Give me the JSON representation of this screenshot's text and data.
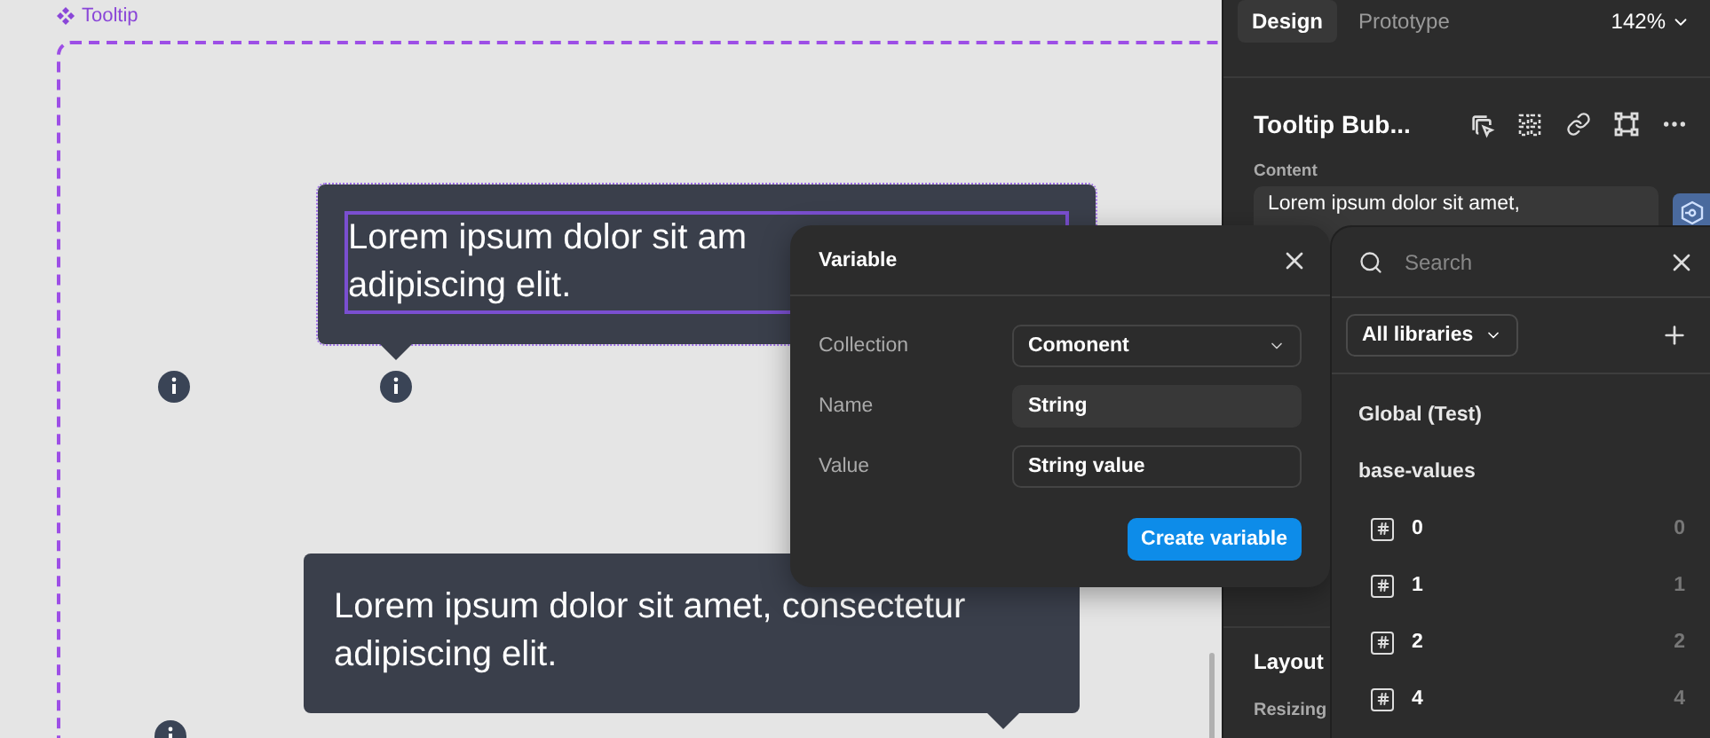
{
  "canvas": {
    "frame_label": "Tooltip",
    "tooltips": [
      {
        "lines": [
          "Lorem ipsum dolor sit am",
          "adipiscing elit."
        ],
        "selected": true
      },
      {
        "lines": [
          "Lorem ipsum dolor sit amet, consectetur",
          "adipiscing elit."
        ],
        "selected": false
      }
    ]
  },
  "inspector": {
    "tabs": [
      {
        "label": "Design",
        "selected": true
      },
      {
        "label": "Prototype",
        "selected": false
      }
    ],
    "zoom": "142%",
    "layer_title": "Tooltip Bub...",
    "content_label": "Content",
    "content_value": "Lorem ipsum dolor sit amet,",
    "layout_title": "Layout",
    "resizing_label": "Resizing"
  },
  "variable_dialog": {
    "title": "Variable",
    "fields": [
      {
        "label": "Collection",
        "kind": "select",
        "value": "Comonent"
      },
      {
        "label": "Name",
        "kind": "filled",
        "value": "String"
      },
      {
        "label": "Value",
        "kind": "outlined",
        "value": "String value"
      }
    ],
    "submit": "Create variable"
  },
  "library_picker": {
    "search_placeholder": "Search",
    "filter": "All libraries",
    "library": "Global (Test)",
    "group": "base-values",
    "variables": [
      {
        "name": "0",
        "value": "0"
      },
      {
        "name": "1",
        "value": "1"
      },
      {
        "name": "2",
        "value": "2"
      },
      {
        "name": "4",
        "value": "4"
      }
    ]
  }
}
